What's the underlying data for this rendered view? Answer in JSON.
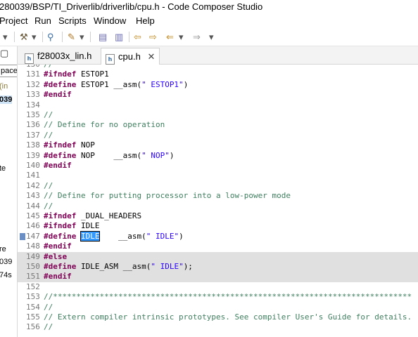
{
  "window": {
    "title": "280039/BSP/TI_Driverlib/driverlib/cpu.h - Code Composer Studio"
  },
  "menubar": {
    "items": [
      "Project",
      "Run",
      "Scripts",
      "Window",
      "Help"
    ]
  },
  "left_panel": {
    "tab_label": "pace",
    "items": [
      "(in",
      "039",
      "te",
      "re",
      "039",
      "74s"
    ]
  },
  "tabs": [
    {
      "label": "f28003x_lin.h",
      "active": false
    },
    {
      "label": "cpu.h",
      "active": true,
      "close": "✕"
    }
  ],
  "editor": {
    "lines": [
      {
        "num": "130",
        "parts": [
          [
            "cm",
            "//"
          ]
        ]
      },
      {
        "num": "131",
        "parts": [
          [
            "kw",
            "#ifndef"
          ],
          [
            "pl",
            " ESTOP1"
          ]
        ]
      },
      {
        "num": "132",
        "parts": [
          [
            "kw",
            "#define"
          ],
          [
            "pl",
            " ESTOP1 __asm("
          ],
          [
            "str",
            "\" ESTOP1\""
          ],
          [
            "pl",
            ")"
          ]
        ]
      },
      {
        "num": "133",
        "parts": [
          [
            "kw",
            "#endif"
          ]
        ]
      },
      {
        "num": "134",
        "parts": []
      },
      {
        "num": "135",
        "parts": [
          [
            "cm",
            "//"
          ]
        ]
      },
      {
        "num": "136",
        "parts": [
          [
            "cm",
            "// Define for no operation"
          ]
        ]
      },
      {
        "num": "137",
        "parts": [
          [
            "cm",
            "//"
          ]
        ]
      },
      {
        "num": "138",
        "parts": [
          [
            "kw",
            "#ifndef"
          ],
          [
            "pl",
            " NOP"
          ]
        ]
      },
      {
        "num": "139",
        "parts": [
          [
            "kw",
            "#define"
          ],
          [
            "pl",
            " NOP    __asm("
          ],
          [
            "str",
            "\" NOP\""
          ],
          [
            "pl",
            ")"
          ]
        ]
      },
      {
        "num": "140",
        "parts": [
          [
            "kw",
            "#endif"
          ]
        ]
      },
      {
        "num": "141",
        "parts": []
      },
      {
        "num": "142",
        "parts": [
          [
            "cm",
            "//"
          ]
        ]
      },
      {
        "num": "143",
        "parts": [
          [
            "cm",
            "// Define for putting processor into a low-power mode"
          ]
        ]
      },
      {
        "num": "144",
        "parts": [
          [
            "cm",
            "//"
          ]
        ]
      },
      {
        "num": "145",
        "parts": [
          [
            "kw",
            "#ifndef"
          ],
          [
            "pl",
            " _DUAL_HEADERS"
          ]
        ]
      },
      {
        "num": "146",
        "parts": [
          [
            "kw",
            "#ifndef"
          ],
          [
            "pl",
            " IDLE"
          ]
        ]
      },
      {
        "num": "147",
        "bookmark": true,
        "parts": [
          [
            "kw",
            "#define"
          ],
          [
            "pl",
            " "
          ],
          [
            "sel",
            "IDLE"
          ],
          [
            "pl",
            "    __asm("
          ],
          [
            "str",
            "\" IDLE\""
          ],
          [
            "pl",
            ")"
          ]
        ]
      },
      {
        "num": "148",
        "parts": [
          [
            "kw",
            "#endif"
          ]
        ]
      },
      {
        "num": "149",
        "hl": true,
        "parts": [
          [
            "kw",
            "#else"
          ]
        ]
      },
      {
        "num": "150",
        "hl": true,
        "parts": [
          [
            "kw",
            "#define"
          ],
          [
            "pl",
            " IDLE_ASM __asm("
          ],
          [
            "str",
            "\" IDLE\""
          ],
          [
            "pl",
            ");"
          ]
        ]
      },
      {
        "num": "151",
        "hl": true,
        "parts": [
          [
            "kw",
            "#endif"
          ]
        ]
      },
      {
        "num": "152",
        "parts": []
      },
      {
        "num": "153",
        "parts": [
          [
            "cm",
            "//*****************************************************************************"
          ]
        ]
      },
      {
        "num": "154",
        "parts": [
          [
            "cm",
            "//"
          ]
        ]
      },
      {
        "num": "155",
        "parts": [
          [
            "cm",
            "// Extern compiler intrinsic prototypes. See compiler User's Guide for details."
          ]
        ]
      },
      {
        "num": "156",
        "parts": [
          [
            "cm",
            "//"
          ]
        ]
      }
    ]
  },
  "colors": {
    "keyword": "#7f0055",
    "comment": "#3f7f5f",
    "string": "#2a00ff",
    "selection": "#3399ff",
    "inactive_block": "#e0e0e0"
  },
  "icons": [
    "window-icon",
    "hammer-build-icon",
    "search-icon",
    "pencil-icon",
    "file-icon",
    "previous-edit-icon",
    "next-edit-icon",
    "back-arrow-icon",
    "forward-arrow-icon"
  ]
}
